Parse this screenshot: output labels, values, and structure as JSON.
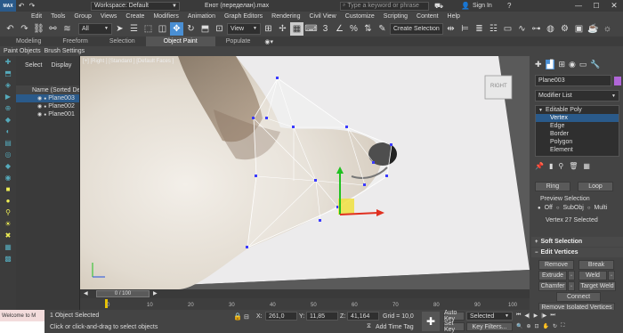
{
  "app": {
    "logo": "MAX",
    "workspace": "Workspace: Default",
    "title": "Енот (переделан).max",
    "search_placeholder": "Type a keyword or phrase",
    "sign_in": "Sign In"
  },
  "menu": [
    "Edit",
    "Tools",
    "Group",
    "Views",
    "Create",
    "Modifiers",
    "Animation",
    "Graph Editors",
    "Rendering",
    "Civil View",
    "Customize",
    "Scripting",
    "Content",
    "Help"
  ],
  "toolbar": {
    "filter": "All",
    "view_dropdown": "View",
    "selection_set": "Create Selection Se"
  },
  "ribbon_tabs": [
    "Modeling",
    "Freeform",
    "Selection",
    "Object Paint",
    "Populate"
  ],
  "ribbon_sub": [
    "Paint Objects",
    "Brush Settings"
  ],
  "scene_explorer": {
    "tabs": [
      "Select",
      "Display"
    ],
    "header": "Name (Sorted Desce",
    "items": [
      "Plane003",
      "Plane002",
      "Plane001"
    ]
  },
  "viewport": {
    "label": "[+] [Right ] [Standard ] [Default Faces ]",
    "viewcube": "RIGHT"
  },
  "command_panel": {
    "object_name": "Plane003",
    "modifier_list": "Modifier List",
    "stack": {
      "root": "Editable Poly",
      "subs": [
        "Vertex",
        "Edge",
        "Border",
        "Polygon",
        "Element"
      ]
    },
    "ring": "Ring",
    "loop": "Loop",
    "preview_label": "Preview Selection",
    "preview_options": [
      "Off",
      "SubObj",
      "Multi"
    ],
    "vertex_count": "Vertex 27 Selected",
    "soft_selection": "Soft Selection",
    "edit_vertices": "Edit Vertices",
    "buttons": {
      "remove": "Remove",
      "break": "Break",
      "extrude": "Extrude",
      "weld": "Weld",
      "chamfer": "Chamfer",
      "target_weld": "Target Weld",
      "connect": "Connect",
      "remove_isolated": "Remove Isolated Vertices"
    }
  },
  "timeline": {
    "frame": "0 / 100",
    "ticks": [
      "0",
      "10",
      "20",
      "30",
      "40",
      "50",
      "60",
      "70",
      "80",
      "90",
      "100"
    ]
  },
  "status": {
    "script_box": "Welcome to M",
    "selected": "1 Object Selected",
    "prompt": "Click or click-and-drag to select objects",
    "x_label": "X:",
    "x": "261,0",
    "y_label": "Y:",
    "y": "11,85",
    "z_label": "Z:",
    "z": "41,164",
    "grid": "Grid = 10,0",
    "add_time_tag": "Add Time Tag",
    "auto_key": "Auto Key",
    "set_key": "Set Key",
    "key_mode": "Selected",
    "key_filters": "Key Filters..."
  },
  "colors": {
    "accent": "#4a8fd4",
    "app_bg": "#444444",
    "setkey_red": "#d04040",
    "selection_highlight": "#2a5a8a"
  }
}
